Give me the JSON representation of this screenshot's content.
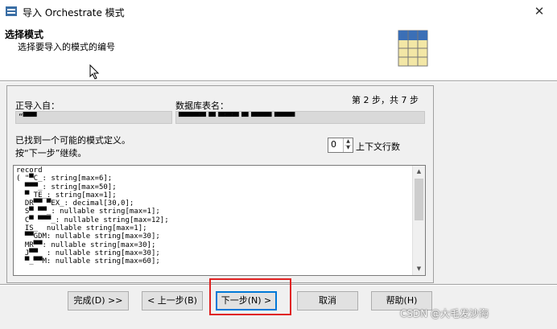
{
  "window": {
    "title": "导入 Orchestrate 模式",
    "close_label": "✕"
  },
  "header": {
    "title": "选择模式",
    "subtitle": "选择要导入的模式的编号"
  },
  "panel": {
    "step_label": "第 2 步，共 7 步",
    "import_from_label": "正导入自：",
    "import_from_value": "“▀▀",
    "table_name_label": "数据库表名：",
    "table_name_value": "▀▀▀▀ ▀ ▀▀▀ ▀ ▀▀▀ ▀▀▀",
    "found_text": "已找到一个可能的模式定义。",
    "continue_text": "按“下一步”继续。",
    "context_lines_value": "0",
    "context_lines_label": "上下文行数",
    "schema_lines": [
      "record",
      "( \"▀C_: string[max=6];",
      "  ▀▀▀_: string[max=50];",
      "  ▀ TE_: string[max=1];",
      "  DR▀▀ ▀EX_: decimal[30,0];",
      "  S▀ ▀▀_: nullable string[max=1];",
      "  C▀ ▀▀▀_: nullable string[max=12];",
      "  IS_  nullable string[max=1];",
      "  ▀▀GDM: nullable string[max=30];",
      "  MR▀▀: nullable string[max=30];",
      "  J▀▀  : nullable string[max=30];",
      "  ▀_▀▀M: nullable string[max=60];"
    ]
  },
  "buttons": {
    "finish": "完成(D) >>",
    "back": "< 上一步(B)",
    "next": "下一步(N) >",
    "cancel": "取消",
    "help": "帮助(H)"
  },
  "watermark": "CSDN @大毛发沙海",
  "colors": {
    "highlight": "#e02020",
    "default_button_border": "#0078d7"
  }
}
